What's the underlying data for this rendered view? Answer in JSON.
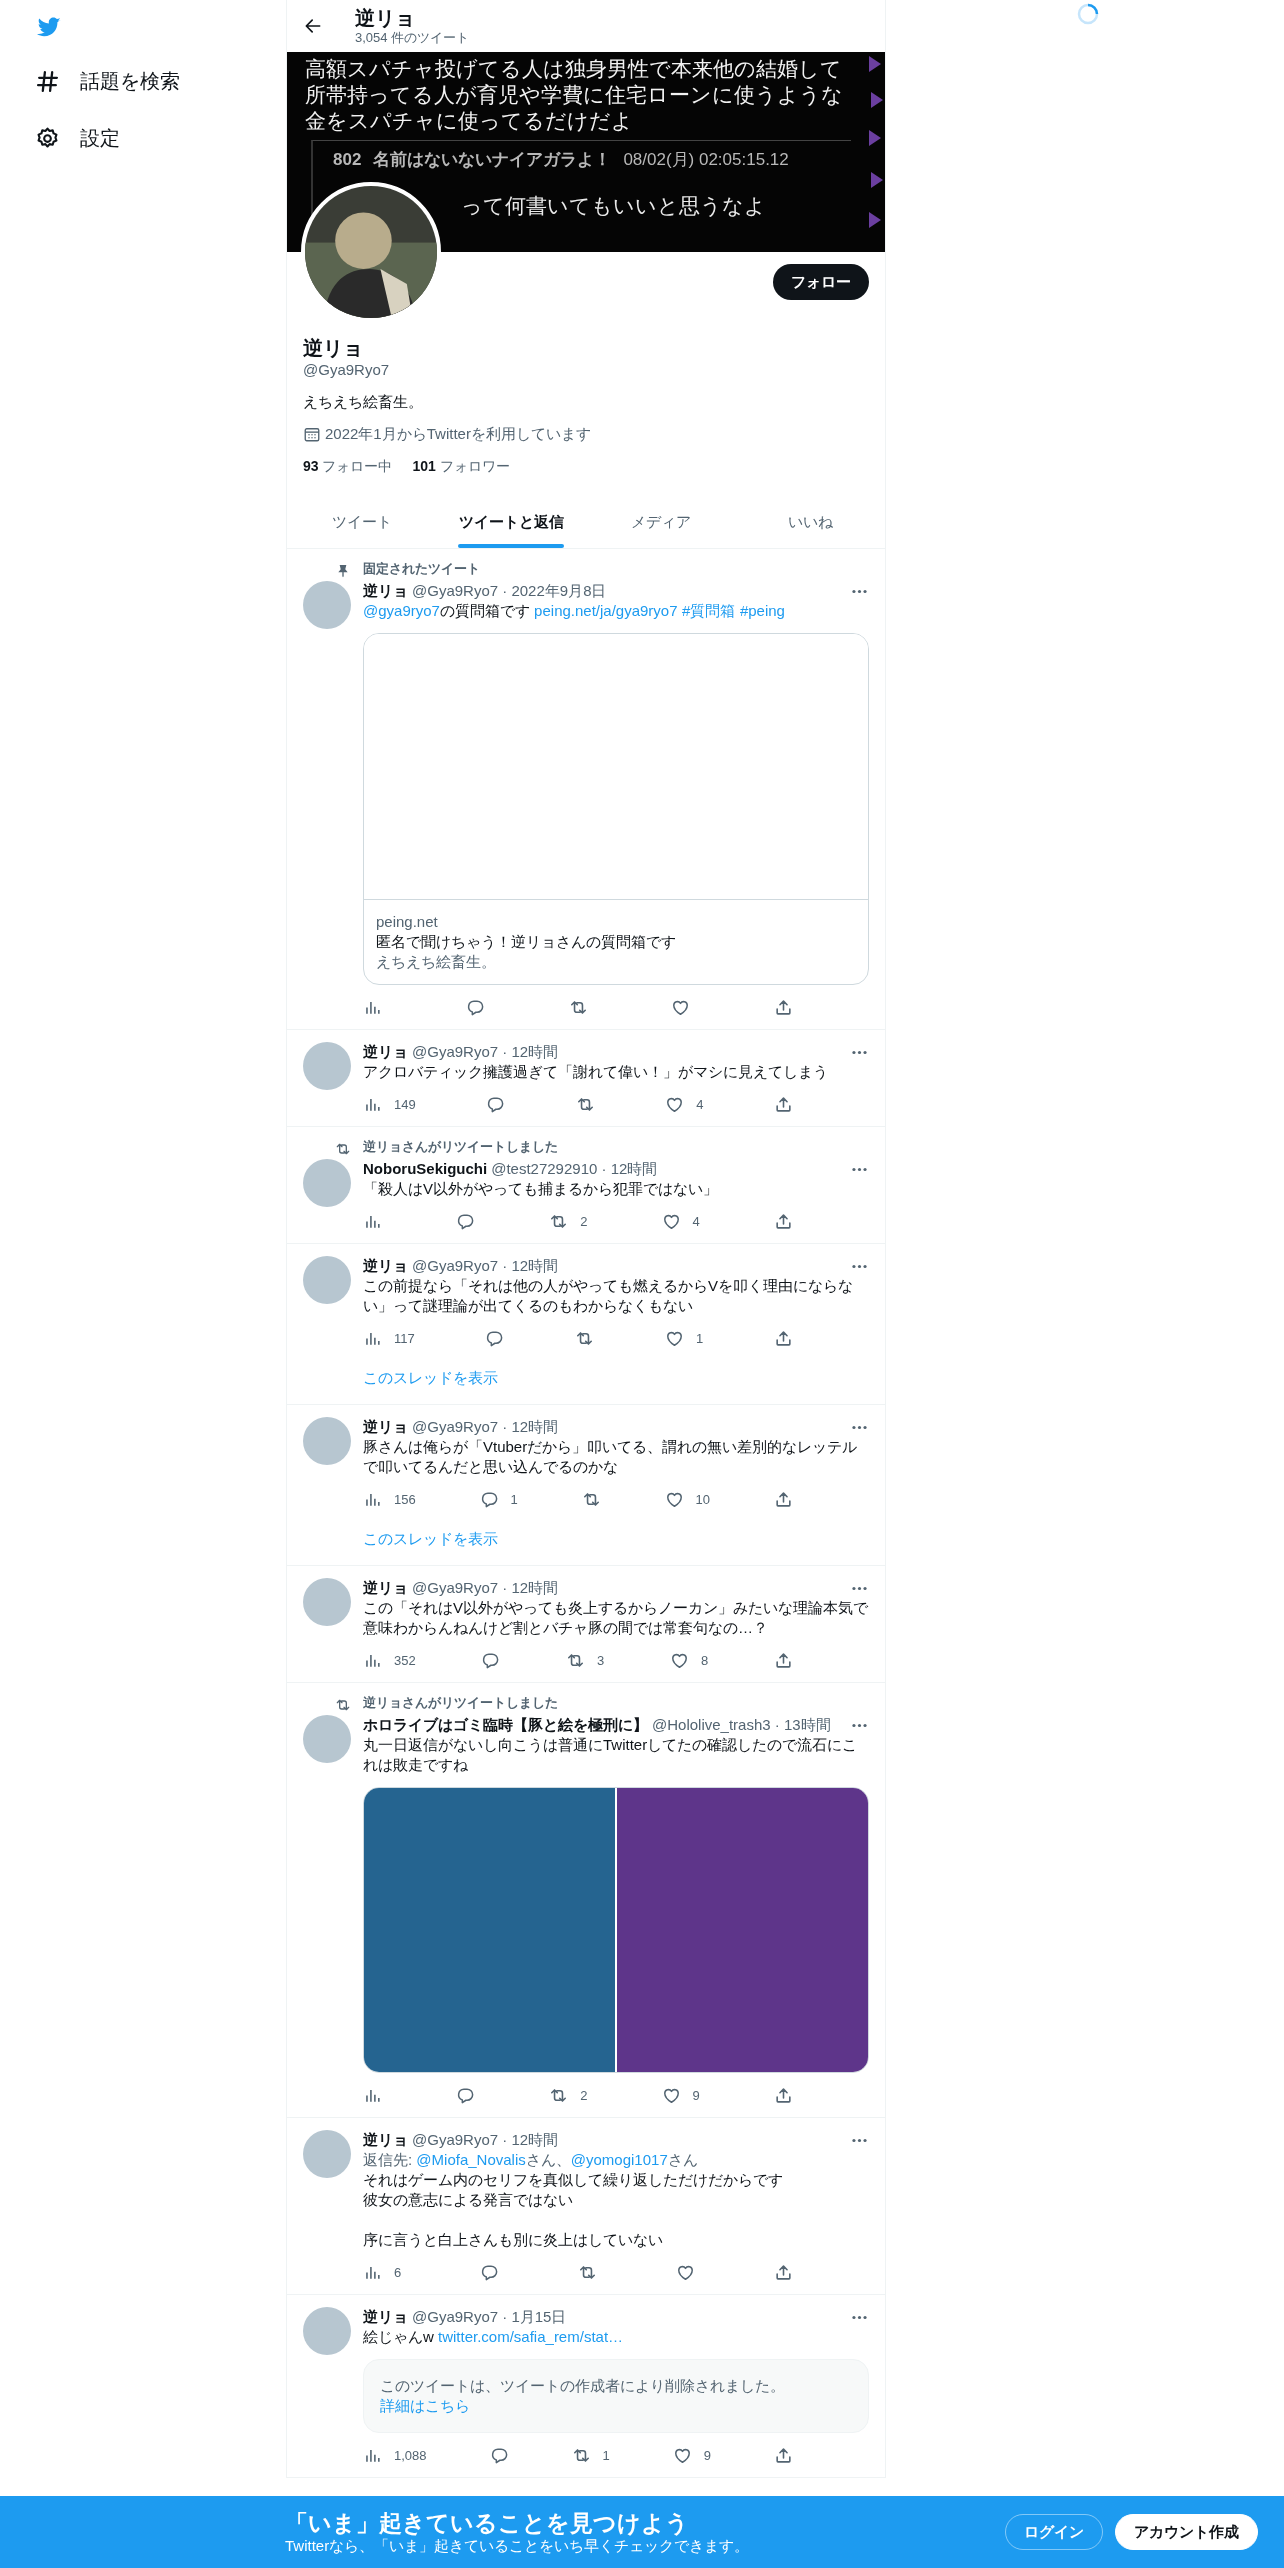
{
  "sidebar": {
    "items": [
      {
        "kind": "hashtag",
        "label": "話題を検索"
      },
      {
        "kind": "gear",
        "label": "設定"
      }
    ]
  },
  "header": {
    "title": "逆リョ",
    "subtitle": "3,054 件のツイート"
  },
  "banner": {
    "text": "高額スパチャ投げてる人は独身男性で本来他の結婚して所帯持ってる人が育児や学費に住宅ローンに使うような金をスパチャに使ってるだけだよ",
    "post_number": "802",
    "poster": "名前はないないナイアガラよ！",
    "timestamp": "08/02(月) 02:05:15.12",
    "quote": "って何書いてもいいと思うなよ"
  },
  "profile": {
    "follow_button": "フォロー",
    "name": "逆リョ",
    "handle": "@Gya9Ryo7",
    "bio": "えちえち絵畜生。",
    "joined": "2022年1月からTwitterを利用しています",
    "stats": [
      {
        "count": "93",
        "label": "フォロー中"
      },
      {
        "count": "101",
        "label": "フォロワー"
      }
    ]
  },
  "tabs": [
    {
      "label": "ツイート",
      "selected": false
    },
    {
      "label": "ツイートと返信",
      "selected": true
    },
    {
      "label": "メディア",
      "selected": false
    },
    {
      "label": "いいね",
      "selected": false
    }
  ],
  "tweets": [
    {
      "context": {
        "kind": "pinned",
        "text": "固定されたツイート"
      },
      "name": "逆リョ",
      "meta": "@Gya9Ryo7 · 2022年9月8日",
      "text": [
        {
          "kind": "mention",
          "text": "@gya9ryo7"
        },
        {
          "kind": "text",
          "text": "の質問箱です "
        },
        {
          "kind": "url",
          "text": "peing.net/ja/gya9ryo7"
        },
        {
          "kind": "hashtag",
          "text": "#質問箱"
        },
        {
          "kind": "hashtag",
          "text": "#peing"
        }
      ],
      "card": {
        "domain": "peing.net",
        "title": "匿名で聞けちゃう！逆リョさんの質問箱です",
        "description": "えちえち絵畜生。"
      },
      "stats": [
        {
          "kind": "views"
        },
        {
          "kind": "reply"
        },
        {
          "kind": "retweet"
        },
        {
          "kind": "like"
        },
        {
          "kind": "share"
        }
      ]
    },
    {
      "name": "逆リョ",
      "meta": "@Gya9Ryo7 · 12時間",
      "text": [
        {
          "kind": "text",
          "text": "アクロバティック擁護過ぎて「謝れて偉い！」がマシに見えてしまう"
        }
      ],
      "stats": [
        {
          "kind": "views",
          "count": "149"
        },
        {
          "kind": "reply"
        },
        {
          "kind": "retweet"
        },
        {
          "kind": "like",
          "count": "4"
        },
        {
          "kind": "share"
        }
      ]
    },
    {
      "context": {
        "kind": "retweet",
        "text": "逆リョさんがリツイートしました"
      },
      "name": "NoboruSekiguchi",
      "meta": "@test27292910 · 12時間",
      "text": [
        {
          "kind": "text",
          "text": "「殺人はV以外がやっても捕まるから犯罪ではない」"
        }
      ],
      "stats": [
        {
          "kind": "views"
        },
        {
          "kind": "reply"
        },
        {
          "kind": "retweet",
          "count": "2"
        },
        {
          "kind": "like",
          "count": "4"
        },
        {
          "kind": "share"
        }
      ]
    },
    {
      "name": "逆リョ",
      "meta": "@Gya9Ryo7 · 12時間",
      "text": [
        {
          "kind": "text",
          "text": "この前提なら「それは他の人がやっても燃えるからVを叩く理由にならない」って謎理論が出てくるのもわからなくもない"
        }
      ],
      "stats": [
        {
          "kind": "views",
          "count": "117"
        },
        {
          "kind": "reply"
        },
        {
          "kind": "retweet"
        },
        {
          "kind": "like",
          "count": "1"
        },
        {
          "kind": "share"
        }
      ],
      "show_thread": "このスレッドを表示"
    },
    {
      "name": "逆リョ",
      "meta": "@Gya9Ryo7 · 12時間",
      "text": [
        {
          "kind": "text",
          "text": "豚さんは俺らが「Vtuberだから」叩いてる、謂れの無い差別的なレッテルで叩いてるんだと思い込んでるのかな"
        }
      ],
      "stats": [
        {
          "kind": "views",
          "count": "156"
        },
        {
          "kind": "reply",
          "count": "1"
        },
        {
          "kind": "retweet"
        },
        {
          "kind": "like",
          "count": "10"
        },
        {
          "kind": "share"
        }
      ],
      "show_thread": "このスレッドを表示"
    },
    {
      "name": "逆リョ",
      "meta": "@Gya9Ryo7 · 12時間",
      "text": [
        {
          "kind": "text",
          "text": "この「それはV以外がやっても炎上するからノーカン」みたいな理論本気で意味わからんねんけど割とバチャ豚の間では常套句なの…？"
        }
      ],
      "stats": [
        {
          "kind": "views",
          "count": "352"
        },
        {
          "kind": "reply"
        },
        {
          "kind": "retweet",
          "count": "3"
        },
        {
          "kind": "like",
          "count": "8"
        },
        {
          "kind": "share"
        }
      ]
    },
    {
      "context": {
        "kind": "retweet",
        "text": "逆リョさんがリツイートしました"
      },
      "name": "ホロライブはゴミ臨時【豚と絵を極刑に】",
      "meta": "@Hololive_trash3 · 13時間",
      "text": [
        {
          "kind": "text",
          "text": "丸一日返信がないし向こうは普通にTwitterしてたの確認したので流石にこれは敗走ですね"
        }
      ],
      "media": [
        {
          "kind": "picture",
          "color": "#256490"
        },
        {
          "kind": "picture",
          "color": "#5e358a"
        }
      ],
      "stats": [
        {
          "kind": "views"
        },
        {
          "kind": "reply"
        },
        {
          "kind": "retweet",
          "count": "2"
        },
        {
          "kind": "like",
          "count": "9"
        },
        {
          "kind": "share"
        }
      ]
    },
    {
      "name": "逆リョ",
      "meta": "@Gya9Ryo7 · 12時間",
      "reply_to": [
        {
          "kind": "text",
          "text": "返信先: "
        },
        {
          "kind": "mention",
          "text": "@Miofa_Novalis"
        },
        {
          "kind": "text",
          "text": "さん、"
        },
        {
          "kind": "mention",
          "text": "@yomogi1017"
        },
        {
          "kind": "text",
          "text": "さん"
        }
      ],
      "text": [
        {
          "kind": "paragraph",
          "lines": [
            "それはゲーム内のセリフを真似して繰り返しただけだからです",
            "彼女の意志による発言ではない"
          ]
        },
        {
          "kind": "paragraph",
          "lines": [
            "序に言うと白上さんも別に炎上はしていない"
          ]
        }
      ],
      "stats": [
        {
          "kind": "views",
          "count": "6"
        },
        {
          "kind": "reply"
        },
        {
          "kind": "retweet"
        },
        {
          "kind": "like"
        },
        {
          "kind": "share"
        }
      ]
    },
    {
      "name": "逆リョ",
      "meta": "@Gya9Ryo7 · 1月15日",
      "text": [
        {
          "kind": "text",
          "text": "絵じゃんw "
        },
        {
          "kind": "url",
          "text": "twitter.com/safia_rem/stat…"
        }
      ],
      "deleted_quote": [
        {
          "kind": "text",
          "text": "このツイートは、ツイートの作成者により削除されました。"
        },
        {
          "kind": "link",
          "text": "詳細はこちら"
        }
      ],
      "stats": [
        {
          "kind": "views",
          "count": "1,088"
        },
        {
          "kind": "reply"
        },
        {
          "kind": "retweet",
          "count": "1"
        },
        {
          "kind": "like",
          "count": "9"
        },
        {
          "kind": "share"
        }
      ]
    }
  ],
  "signup_banner": {
    "title": "「いま」起きていることを見つけよう",
    "subtitle": "Twitterなら、「いま」起きていることをいち早くチェックできます。",
    "buttons": [
      {
        "kind": "outline",
        "label": "ログイン"
      },
      {
        "kind": "filled",
        "label": "アカウント作成"
      }
    ]
  }
}
